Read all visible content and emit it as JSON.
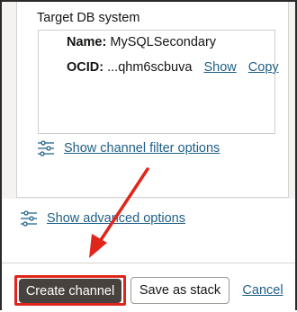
{
  "target_db": {
    "section_label": "Target DB system",
    "name_label": "Name:",
    "name_value": "MySQLSecondary",
    "ocid_label": "OCID:",
    "ocid_value": "...qhm6scbuva",
    "show_label": "Show",
    "copy_label": "Copy"
  },
  "links": {
    "channel_filter": "Show channel filter options",
    "advanced_options": "Show advanced options"
  },
  "footer": {
    "create_label": "Create channel",
    "save_stack_label": "Save as stack",
    "cancel_label": "Cancel"
  },
  "colors": {
    "link": "#1f5f86",
    "primary_button": "#47423d",
    "annotation": "#e0251b",
    "panel_bg": "#f4f3f2"
  },
  "icons": {
    "filter_options": "sliders-icon",
    "advanced_options": "sliders-icon"
  }
}
